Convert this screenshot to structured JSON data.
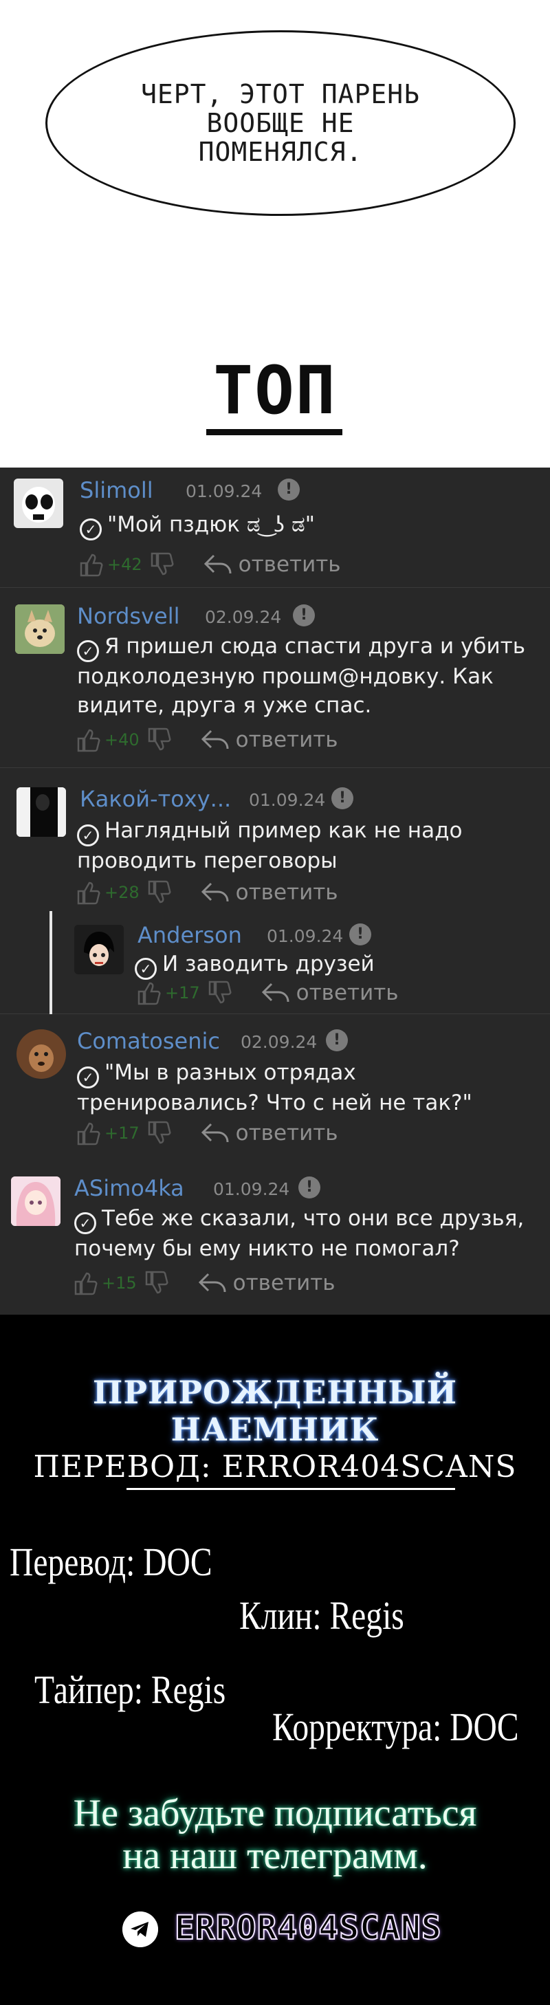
{
  "panel": {
    "speech_bubble_text": "ЧЕРТ, ЭТОТ ПАРЕНЬ ВООБЩЕ НЕ ПОМЕНЯЛСЯ.",
    "heading": "ТОП"
  },
  "comments": [
    {
      "user": "Slimoll",
      "date": "01.09.24",
      "text": "\"Мой пздюк ಡ ͜ ʖ ಡ\"",
      "score": "+42",
      "reply_label": "ответить",
      "avatar": "skull-avatar"
    },
    {
      "user": "Nordsvell",
      "date": "02.09.24",
      "text": "Я пришел сюда спасти друга и убить подколодезную прошм@ндовку. Как видите, друга я уже спас.",
      "score": "+40",
      "reply_label": "ответить",
      "avatar": "dog-avatar"
    },
    {
      "user": "Какой-тоху...",
      "date": "01.09.24",
      "text": "Наглядный пример как не надо проводить переговоры",
      "score": "+28",
      "reply_label": "ответить",
      "avatar": "dark-figure-avatar"
    },
    {
      "user": "Anderson",
      "date": "01.09.24",
      "text": "И заводить друзей",
      "score": "+17",
      "reply_label": "ответить",
      "avatar": "anime-avatar"
    },
    {
      "user": "Comatosenic",
      "date": "02.09.24",
      "text": "\"Мы в разных отрядах тренировались? Что с ней не так?\"",
      "score": "+17",
      "reply_label": "ответить",
      "avatar": "cat-avatar"
    },
    {
      "user": "ASimo4ka",
      "date": "01.09.24",
      "text": "Тебе же сказали, что они все друзья, почему бы ему никто не помогал?",
      "score": "+15",
      "reply_label": "ответить",
      "avatar": "anime-girl-avatar"
    }
  ],
  "credits": {
    "title": "ПРИРОЖДЕННЫЙ НАЕМНИК",
    "subtitle": "ПЕРЕВОД: ERROR404SCANS",
    "translation": "Перевод: DOC",
    "cleaning": "Клин: Regis",
    "typesetting": "Тайпер: Regis",
    "proofreading": "Корректура: DOC",
    "reminder": "Не забудьте подписаться на наш телеграмм.",
    "telegram_handle": "ERROR404SCANS"
  },
  "colors": {
    "comment_bg": "#282828",
    "username": "#5e8ec9",
    "date": "#8b8b8b",
    "score": "#2e6b2e",
    "credits_bg": "#000000"
  }
}
